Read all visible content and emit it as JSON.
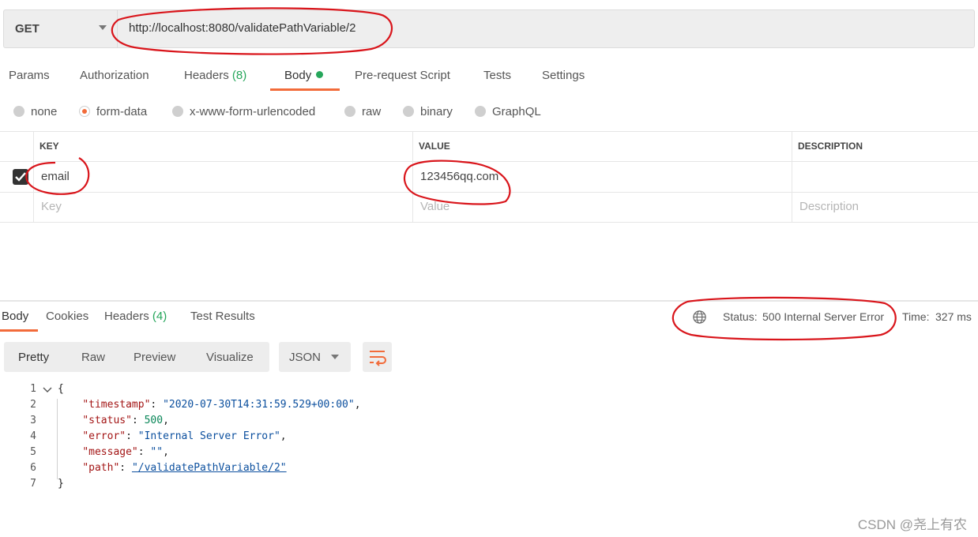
{
  "request": {
    "method": "GET",
    "url": "http://localhost:8080/validatePathVariable/2",
    "tabs": {
      "params": "Params",
      "authorization": "Authorization",
      "headers": "Headers",
      "headers_count": "(8)",
      "body": "Body",
      "prerequest": "Pre-request Script",
      "tests": "Tests",
      "settings": "Settings"
    },
    "body_types": {
      "none": "none",
      "form_data": "form-data",
      "urlencoded": "x-www-form-urlencoded",
      "raw": "raw",
      "binary": "binary",
      "graphql": "GraphQL"
    },
    "selected_body_type": "form-data",
    "table": {
      "headers": {
        "key": "KEY",
        "value": "VALUE",
        "description": "DESCRIPTION"
      },
      "row": {
        "key": "email",
        "value": "123456qq.com",
        "checked": true
      },
      "placeholders": {
        "key": "Key",
        "value": "Value",
        "description": "Description"
      }
    }
  },
  "response": {
    "tabs": {
      "body": "Body",
      "cookies": "Cookies",
      "headers": "Headers",
      "headers_count": "(4)",
      "test_results": "Test Results"
    },
    "status_label": "Status:",
    "status_value": "500 Internal Server Error",
    "time_label": "Time:",
    "time_value": "327 ms",
    "view_modes": {
      "pretty": "Pretty",
      "raw": "Raw",
      "preview": "Preview",
      "visualize": "Visualize"
    },
    "format": "JSON",
    "line_numbers": [
      "1",
      "2",
      "3",
      "4",
      "5",
      "6",
      "7"
    ],
    "json": {
      "open": "{",
      "close": "}",
      "timestamp_key": "\"timestamp\"",
      "timestamp_value": "\"2020-07-30T14:31:59.529+00:00\"",
      "status_key": "\"status\"",
      "status_value": "500",
      "error_key": "\"error\"",
      "error_value": "\"Internal Server Error\"",
      "message_key": "\"message\"",
      "message_value": "\"\"",
      "path_key": "\"path\"",
      "path_value": "\"/validatePathVariable/2\""
    }
  },
  "watermark": "CSDN @尧上有农",
  "colors": {
    "accent": "#f26b3a",
    "success": "#26a65b",
    "annotation": "#d9151b"
  }
}
